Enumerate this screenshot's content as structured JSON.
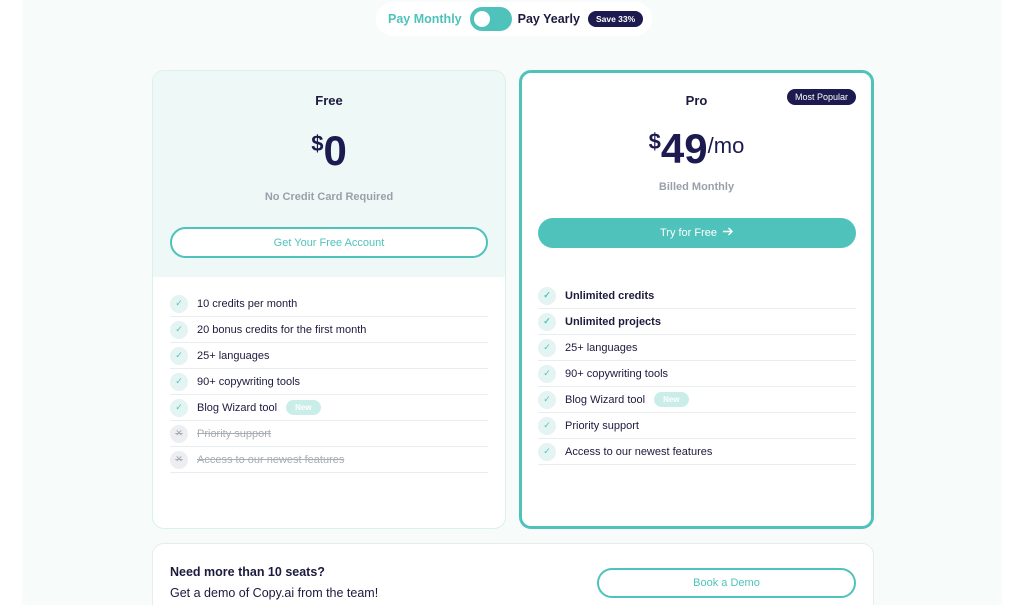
{
  "billing": {
    "monthly_label": "Pay Monthly",
    "yearly_label": "Pay Yearly",
    "save_badge": "Save 33%"
  },
  "free_plan": {
    "name": "Free",
    "currency": "$",
    "amount": "0",
    "note": "No Credit Card Required",
    "cta": "Get Your Free Account",
    "features": [
      {
        "label": "10 credits per month",
        "included": true
      },
      {
        "label": "20 bonus credits for the first month",
        "included": true
      },
      {
        "label": "25+ languages",
        "included": true
      },
      {
        "label": "90+ copywriting tools",
        "included": true
      },
      {
        "label": "Blog Wizard tool",
        "included": true,
        "badge": "New"
      },
      {
        "label": "Priority support",
        "included": false
      },
      {
        "label": "Access to our newest features",
        "included": false
      }
    ]
  },
  "pro_plan": {
    "name": "Pro",
    "popular_badge": "Most Popular",
    "currency": "$",
    "amount": "49",
    "period": "/mo",
    "note": "Billed Monthly",
    "cta": "Try for Free",
    "cta_icon": "arrow-right-icon",
    "features": [
      {
        "label": "Unlimited credits",
        "included": true,
        "bold": true
      },
      {
        "label": "Unlimited projects",
        "included": true,
        "bold": true
      },
      {
        "label": "25+ languages",
        "included": true
      },
      {
        "label": "90+ copywriting tools",
        "included": true
      },
      {
        "label": "Blog Wizard tool",
        "included": true,
        "badge": "New"
      },
      {
        "label": "Priority support",
        "included": true
      },
      {
        "label": "Access to our newest features",
        "included": true
      }
    ]
  },
  "teams": {
    "title": "Need more than 10 seats?",
    "subtitle": "Get a demo of Copy.ai from the team!",
    "cta": "Book a Demo"
  },
  "colors": {
    "accent": "#4fc3bb",
    "navy": "#1c1a4e",
    "free_header_bg": "#eef8f7",
    "muted_text": "#9aa0aa"
  }
}
